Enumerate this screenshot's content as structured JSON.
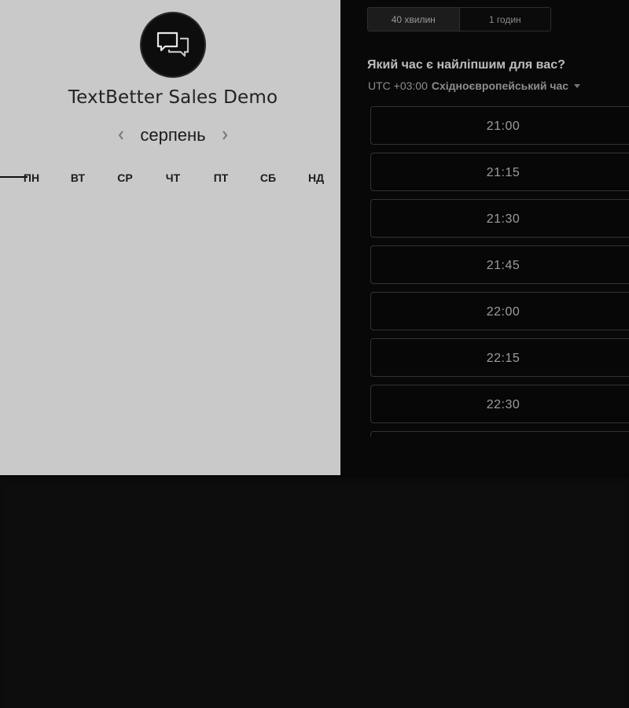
{
  "event": {
    "title": "TextBetter Sales Demo",
    "logo_icon": "chat-bubbles-icon"
  },
  "calendar": {
    "month": "серпень",
    "prev_icon": "chevron-left-icon",
    "next_icon": "chevron-right-icon",
    "weekdays": [
      "ПН",
      "ВТ",
      "СР",
      "ЧТ",
      "ПТ",
      "СБ",
      "НД"
    ]
  },
  "duration": {
    "options": [
      {
        "label": "40 хвилин",
        "selected": true
      },
      {
        "label": "1 годин",
        "selected": false
      }
    ]
  },
  "times": {
    "question": "Який час є найліпшим для вас?",
    "timezone_offset": "UTC +03:00",
    "timezone_name": "Східноєвропейський час",
    "slots": [
      "21:00",
      "21:15",
      "21:30",
      "21:45",
      "22:00",
      "22:15",
      "22:30"
    ]
  },
  "colors": {
    "left_panel_bg": "#c9c9c9",
    "right_panel_bg": "#080808",
    "page_bg": "#0d0d0d"
  }
}
